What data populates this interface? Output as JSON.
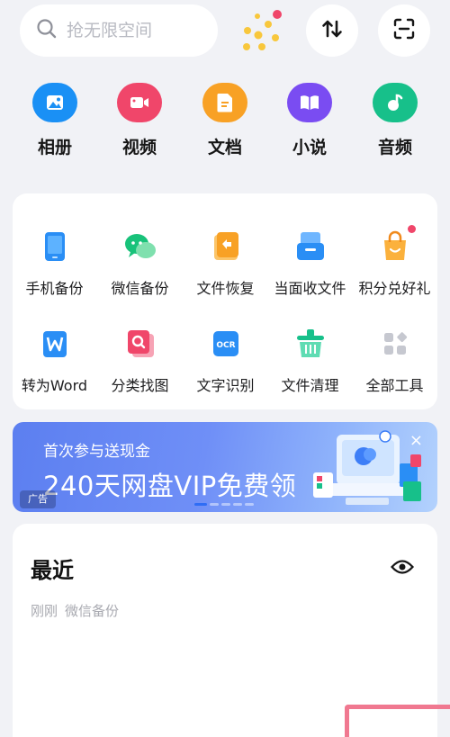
{
  "search": {
    "placeholder": "抢无限空间"
  },
  "header_icons": [
    "search-icon",
    "coins-icon",
    "transfer-icon",
    "scan-icon"
  ],
  "categories": [
    {
      "label": "相册",
      "icon": "photo-album-icon",
      "color": "#1a90f5"
    },
    {
      "label": "视频",
      "icon": "video-icon",
      "color": "#f0466a"
    },
    {
      "label": "文档",
      "icon": "document-icon",
      "color": "#f8a125"
    },
    {
      "label": "小说",
      "icon": "book-icon",
      "color": "#7a4cf2"
    },
    {
      "label": "音频",
      "icon": "music-icon",
      "color": "#17c08a"
    }
  ],
  "tools": [
    {
      "label": "手机备份",
      "icon": "phone-backup-icon"
    },
    {
      "label": "微信备份",
      "icon": "wechat-backup-icon"
    },
    {
      "label": "文件恢复",
      "icon": "file-restore-icon"
    },
    {
      "label": "当面收文件",
      "icon": "inbox-icon"
    },
    {
      "label": "积分兑好礼",
      "icon": "gift-bag-icon",
      "badge": true
    },
    {
      "label": "转为Word",
      "icon": "word-convert-icon"
    },
    {
      "label": "分类找图",
      "icon": "image-search-icon"
    },
    {
      "label": "文字识别",
      "icon": "ocr-icon",
      "icon_text": "OCR"
    },
    {
      "label": "文件清理",
      "icon": "clean-basket-icon"
    },
    {
      "label": "全部工具",
      "icon": "all-tools-icon"
    }
  ],
  "banner": {
    "subtitle": "首次参与送现金",
    "title": "240天网盘VIP免费领",
    "ad_label": "广告",
    "close": "×"
  },
  "recent": {
    "title": "最近",
    "time": "刚刚",
    "source": "微信备份"
  }
}
